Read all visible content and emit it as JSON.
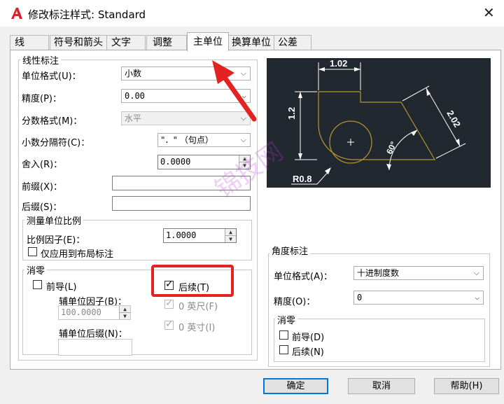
{
  "window": {
    "title": "修改标注样式: Standard",
    "close_icon": "close-icon",
    "app_icon": "autocad-logo-icon"
  },
  "tabs": [
    {
      "label": "线",
      "active": false
    },
    {
      "label": "符号和箭头",
      "active": false
    },
    {
      "label": "文字",
      "active": false
    },
    {
      "label": "调整",
      "active": false
    },
    {
      "label": "主单位",
      "active": true
    },
    {
      "label": "换算单位",
      "active": false
    },
    {
      "label": "公差",
      "active": false
    }
  ],
  "linear": {
    "legend": "线性标注",
    "unit_format": {
      "label": "单位格式(U)：",
      "value": "小数"
    },
    "precision": {
      "label": "精度(P)：",
      "value": "0.00"
    },
    "fraction_format": {
      "label": "分数格式(M)：",
      "value": "水平"
    },
    "decimal_separator": {
      "label": "小数分隔符(C)：",
      "value": "\"．\" （句点）"
    },
    "round_off": {
      "label": "舍入(R)：",
      "value": "0.0000"
    },
    "prefix": {
      "label": "前缀(X)：",
      "value": ""
    },
    "suffix": {
      "label": "后缀(S)：",
      "value": ""
    },
    "measurement_scale": {
      "legend": "测量单位比例",
      "scale_factor": {
        "label": "比例因子(E)：",
        "value": "1.0000"
      },
      "layout_only": {
        "label": "仅应用到布局标注",
        "checked": false
      }
    },
    "zero_suppression": {
      "legend": "消零",
      "leading": {
        "label": "前导(L)",
        "checked": false
      },
      "sub_unit_factor": {
        "label": "辅单位因子(B)：",
        "value": "100.0000"
      },
      "sub_unit_suffix": {
        "label": "辅单位后缀(N)：",
        "value": ""
      },
      "trailing": {
        "label": "后续(T)",
        "checked": true
      },
      "feet": {
        "label": "0 英尺(F)",
        "checked": true
      },
      "inches": {
        "label": "0 英寸(I)",
        "checked": true
      }
    }
  },
  "preview": {
    "dim_top": "1.02",
    "dim_left": "1.2",
    "dim_diag": "2.02",
    "angle": "60°",
    "radius": "R0.8",
    "line_color": "#b8962e",
    "dim_color": "#ffffff",
    "bg_color": "#212830"
  },
  "angular": {
    "legend": "角度标注",
    "unit_format": {
      "label": "单位格式(A)：",
      "value": "十进制度数"
    },
    "precision": {
      "label": "精度(O)：",
      "value": "0"
    },
    "zero_suppression": {
      "legend": "消零",
      "leading": {
        "label": "前导(D)",
        "checked": false
      },
      "trailing": {
        "label": "后续(N)",
        "checked": false
      }
    }
  },
  "buttons": {
    "ok": "确定",
    "cancel": "取消",
    "help": "帮助(H)"
  },
  "watermark": "锦技网",
  "annotation": {
    "arrow_color": "#e32222",
    "box_color": "#e32222"
  }
}
